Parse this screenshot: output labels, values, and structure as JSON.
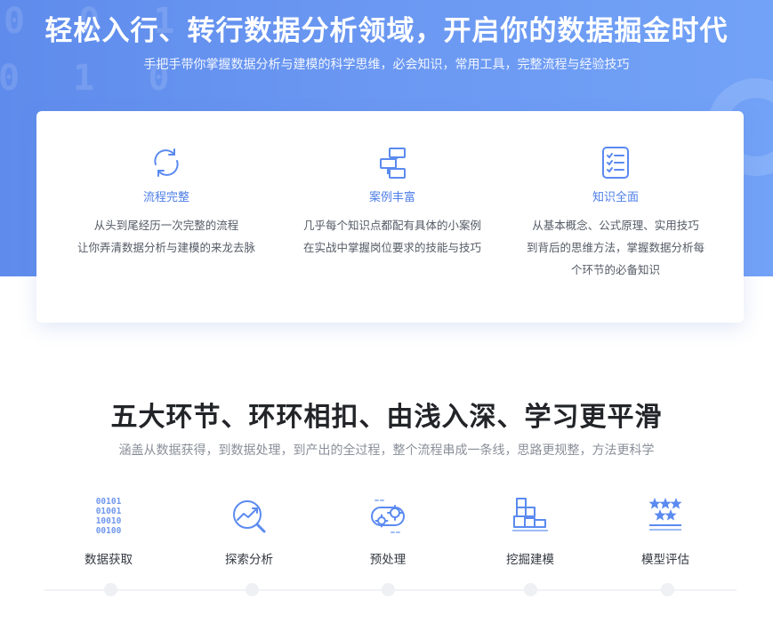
{
  "hero": {
    "title": "轻松入行、转行数据分析领域，开启你的数据掘金时代",
    "subtitle": "手把手带你掌握数据分析与建模的科学思维，必会知识，常用工具，完整流程与经验技巧",
    "decor_row_1": "0 0 1",
    "decor_row_2": "0 1 0"
  },
  "features": [
    {
      "icon": "refresh-cycle-icon",
      "title": "流程完整",
      "lines": [
        "从头到尾经历一次完整的流程",
        "让你弄清数据分析与建模的来龙去脉"
      ]
    },
    {
      "icon": "flow-diagram-icon",
      "title": "案例丰富",
      "lines": [
        "几乎每个知识点都配有具体的小案例",
        "在实战中掌握岗位要求的技能与技巧"
      ]
    },
    {
      "icon": "checklist-icon",
      "title": "知识全面",
      "lines": [
        "从基本概念、公式原理、实用技巧",
        "到背后的思维方法，掌握数据分析每",
        "个环节的必备知识"
      ]
    }
  ],
  "section": {
    "title": "五大环节、环环相扣、由浅入深、学习更平滑",
    "subtitle": "涵盖从数据获得，到数据处理，到产出的全过程，整个流程串成一条线，思路更规整，方法更科学"
  },
  "binary_icon_rows": [
    "00101",
    "01001",
    "10010",
    "00100"
  ],
  "stages": [
    {
      "icon": "binary-data-icon",
      "label": "数据获取"
    },
    {
      "icon": "magnifier-chart-icon",
      "label": "探索分析"
    },
    {
      "icon": "gears-conveyor-icon",
      "label": "预处理"
    },
    {
      "icon": "blocks-build-icon",
      "label": "挖掘建模"
    },
    {
      "icon": "stars-rating-icon",
      "label": "模型评估"
    }
  ],
  "colors": {
    "hero_gradient_start": "#5f8cec",
    "hero_gradient_end": "#72a2f7",
    "accent": "#4d7ee8",
    "icon_light": "#9dbcf7"
  }
}
